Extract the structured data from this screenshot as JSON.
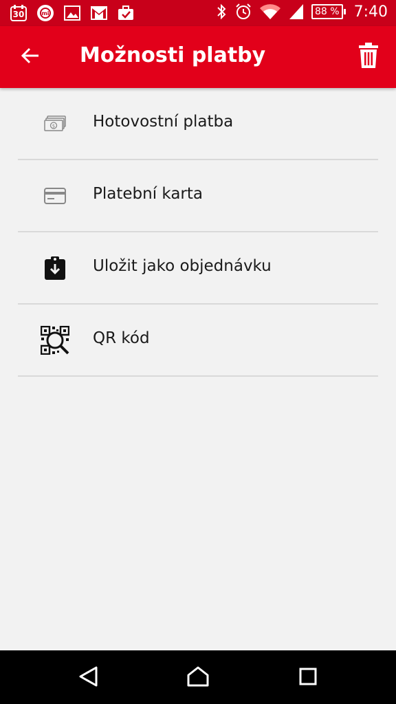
{
  "status_bar": {
    "date_badge": "30",
    "battery": "88 %",
    "time": "7:40"
  },
  "app_bar": {
    "title": "Možnosti platby"
  },
  "payment_options": [
    {
      "label": "Hotovostní platba",
      "icon": "cash-icon"
    },
    {
      "label": "Platební karta",
      "icon": "credit-card-icon"
    },
    {
      "label": "Uložit jako objednávku",
      "icon": "clipboard-download-icon"
    },
    {
      "label": "QR kód",
      "icon": "qr-code-icon"
    }
  ],
  "colors": {
    "accent": "#e2001a",
    "status_bar": "#c8001a",
    "background": "#f2f2f2"
  }
}
